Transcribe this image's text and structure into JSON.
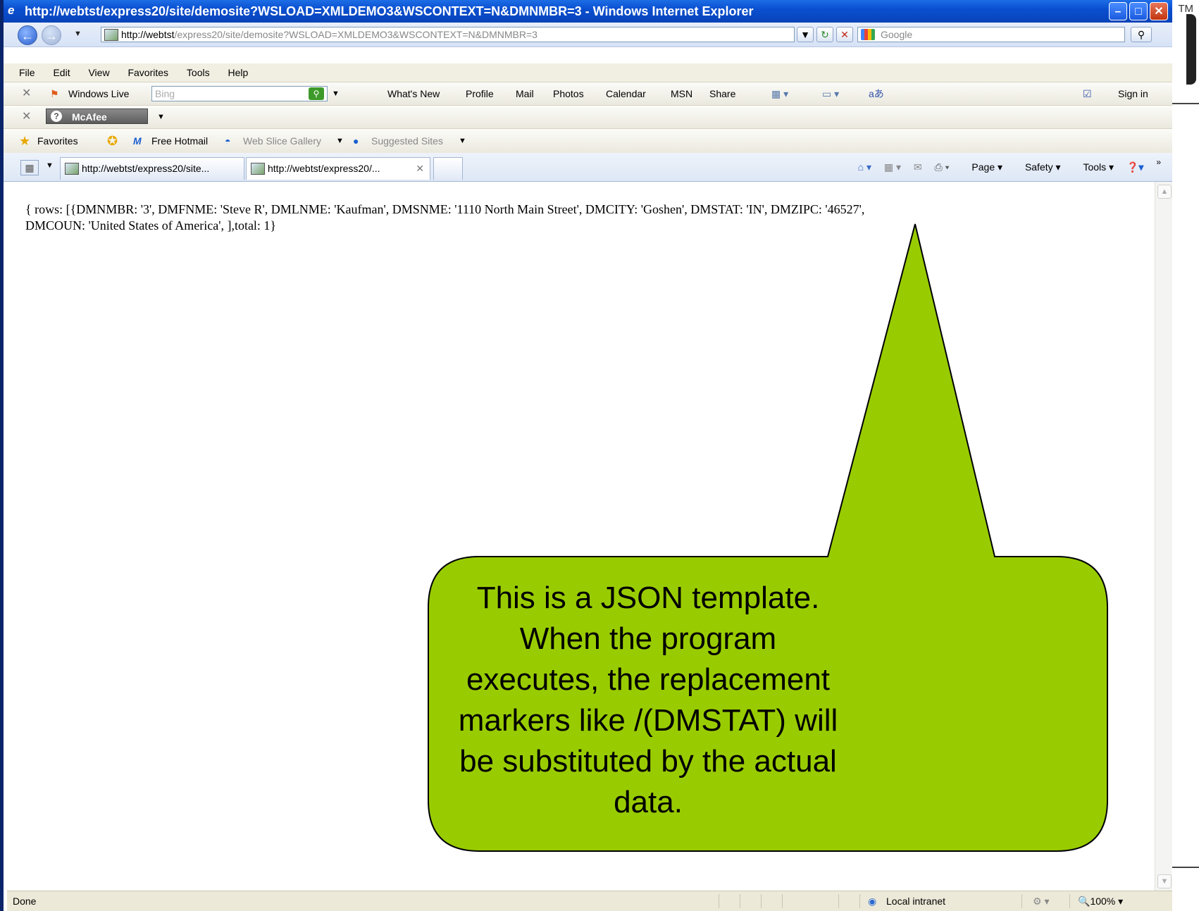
{
  "window": {
    "title": "http://webtst/express20/site/demosite?WSLOAD=XMLDEMO3&WSCONTEXT=N&DMNMBR=3 - Windows Internet Explorer",
    "controls": {
      "minimize": "–",
      "maximize": "□",
      "close": "✕"
    }
  },
  "slide": {
    "trademark": "TM"
  },
  "address": {
    "host": "http://webtst",
    "path": "/express20/site/demosite?WSLOAD=XMLDEMO3&WSCONTEXT=N&DMNMBR=3",
    "search_placeholder": "Google"
  },
  "menu": {
    "items": [
      "File",
      "Edit",
      "View",
      "Favorites",
      "Tools",
      "Help"
    ]
  },
  "live_toolbar": {
    "brand": "Windows Live",
    "search_placeholder": "Bing",
    "links": [
      "What's New",
      "Profile",
      "Mail",
      "Photos",
      "Calendar",
      "MSN",
      "Share"
    ],
    "sign_in": "Sign in"
  },
  "mcafee": {
    "label": "McAfee"
  },
  "favorites_bar": {
    "favorites": "Favorites",
    "items": [
      "Free Hotmail",
      "Web Slice Gallery",
      "Suggested Sites"
    ]
  },
  "tabs": [
    {
      "label": "http://webtst/express20/site..."
    },
    {
      "label": "http://webtst/express20/..."
    }
  ],
  "command_bar": {
    "page": "Page",
    "safety": "Safety",
    "tools": "Tools"
  },
  "content": {
    "json_line1": "{ rows: [{DMNMBR: '3', DMFNME: 'Steve R', DMLNME: 'Kaufman', DMSNME: '1110 North Main Street', DMCITY: 'Goshen', DMSTAT: 'IN', DMZIPC: '46527',",
    "json_line2": "DMCOUN: 'United States of America', ],total: 1}"
  },
  "callout": {
    "text": "This is a JSON template. When the program executes, the replacement markers like /(DMSTAT) will be substituted by the actual data.",
    "fill": "#99cc00"
  },
  "status": {
    "left": "Done",
    "zone": "Local intranet",
    "zoom": "100%"
  }
}
